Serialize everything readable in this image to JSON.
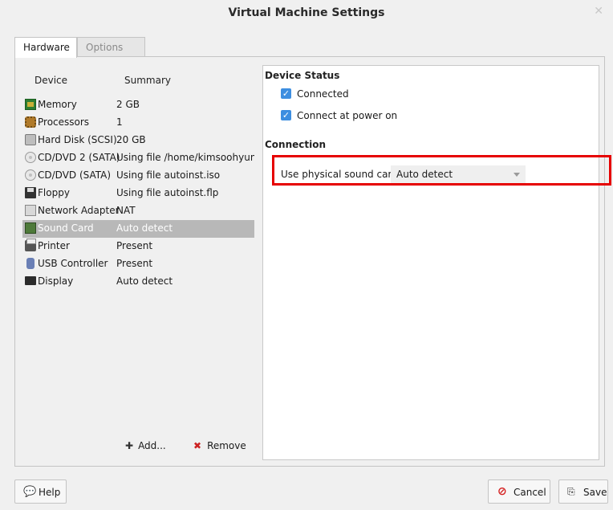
{
  "window": {
    "title": "Virtual Machine Settings",
    "close_glyph": "✕"
  },
  "tabs": [
    {
      "label": "Hardware",
      "active": true
    },
    {
      "label": "Options",
      "active": false
    }
  ],
  "device_list": {
    "headers": {
      "device": "Device",
      "summary": "Summary"
    },
    "items": [
      {
        "name": "Memory",
        "summary": "2 GB",
        "icon": "memory-icon"
      },
      {
        "name": "Processors",
        "summary": "1",
        "icon": "processor-icon"
      },
      {
        "name": "Hard Disk (SCSI)",
        "summary": "20 GB",
        "icon": "hard-disk-icon"
      },
      {
        "name": "CD/DVD 2 (SATA)",
        "summary": "Using file /home/kimsoohyun/D",
        "icon": "cd-dvd-icon"
      },
      {
        "name": "CD/DVD (SATA)",
        "summary": "Using file autoinst.iso",
        "icon": "cd-dvd-icon"
      },
      {
        "name": "Floppy",
        "summary": "Using file autoinst.flp",
        "icon": "floppy-icon"
      },
      {
        "name": "Network Adapter",
        "summary": "NAT",
        "icon": "network-adapter-icon"
      },
      {
        "name": "Sound Card",
        "summary": "Auto detect",
        "icon": "sound-card-icon",
        "selected": true
      },
      {
        "name": "Printer",
        "summary": "Present",
        "icon": "printer-icon"
      },
      {
        "name": "USB Controller",
        "summary": "Present",
        "icon": "usb-controller-icon"
      },
      {
        "name": "Display",
        "summary": "Auto detect",
        "icon": "display-icon"
      }
    ],
    "add_label": "Add...",
    "remove_label": "Remove"
  },
  "device_status": {
    "title": "Device Status",
    "connected_label": "Connected",
    "connected_checked": true,
    "connect_power_label": "Connect at power on",
    "connect_power_checked": true
  },
  "connection": {
    "title": "Connection",
    "sound_card_label": "Use physical sound card:",
    "sound_card_value": "Auto detect"
  },
  "footer": {
    "help_label": "Help",
    "cancel_label": "Cancel",
    "save_label": "Save"
  },
  "colors": {
    "highlight": "#e60000",
    "checkbox": "#3d8ee0",
    "selected_row": "#b8b8b8"
  }
}
